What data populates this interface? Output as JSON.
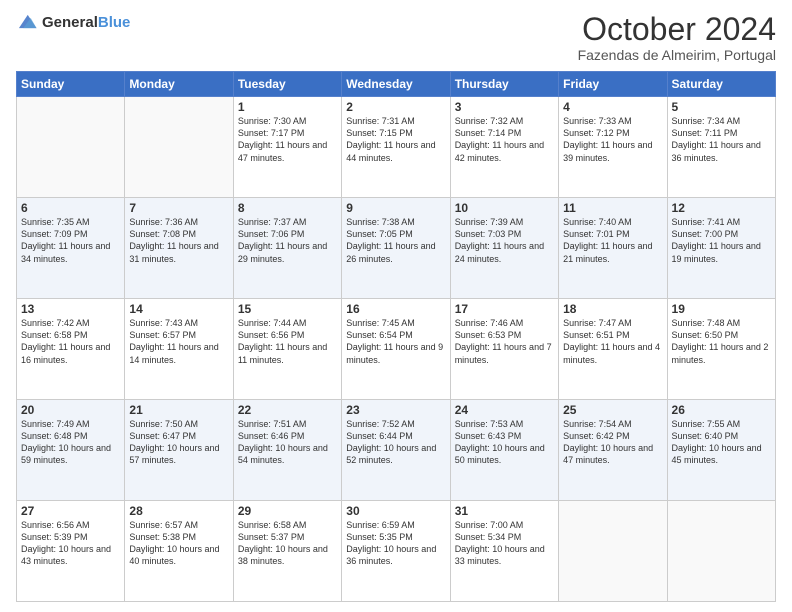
{
  "header": {
    "logo_general": "General",
    "logo_blue": "Blue",
    "main_title": "October 2024",
    "subtitle": "Fazendas de Almeirim, Portugal"
  },
  "days_of_week": [
    "Sunday",
    "Monday",
    "Tuesday",
    "Wednesday",
    "Thursday",
    "Friday",
    "Saturday"
  ],
  "weeks": [
    [
      {
        "day": "",
        "sunrise": "",
        "sunset": "",
        "daylight": ""
      },
      {
        "day": "",
        "sunrise": "",
        "sunset": "",
        "daylight": ""
      },
      {
        "day": "1",
        "sunrise": "Sunrise: 7:30 AM",
        "sunset": "Sunset: 7:17 PM",
        "daylight": "Daylight: 11 hours and 47 minutes."
      },
      {
        "day": "2",
        "sunrise": "Sunrise: 7:31 AM",
        "sunset": "Sunset: 7:15 PM",
        "daylight": "Daylight: 11 hours and 44 minutes."
      },
      {
        "day": "3",
        "sunrise": "Sunrise: 7:32 AM",
        "sunset": "Sunset: 7:14 PM",
        "daylight": "Daylight: 11 hours and 42 minutes."
      },
      {
        "day": "4",
        "sunrise": "Sunrise: 7:33 AM",
        "sunset": "Sunset: 7:12 PM",
        "daylight": "Daylight: 11 hours and 39 minutes."
      },
      {
        "day": "5",
        "sunrise": "Sunrise: 7:34 AM",
        "sunset": "Sunset: 7:11 PM",
        "daylight": "Daylight: 11 hours and 36 minutes."
      }
    ],
    [
      {
        "day": "6",
        "sunrise": "Sunrise: 7:35 AM",
        "sunset": "Sunset: 7:09 PM",
        "daylight": "Daylight: 11 hours and 34 minutes."
      },
      {
        "day": "7",
        "sunrise": "Sunrise: 7:36 AM",
        "sunset": "Sunset: 7:08 PM",
        "daylight": "Daylight: 11 hours and 31 minutes."
      },
      {
        "day": "8",
        "sunrise": "Sunrise: 7:37 AM",
        "sunset": "Sunset: 7:06 PM",
        "daylight": "Daylight: 11 hours and 29 minutes."
      },
      {
        "day": "9",
        "sunrise": "Sunrise: 7:38 AM",
        "sunset": "Sunset: 7:05 PM",
        "daylight": "Daylight: 11 hours and 26 minutes."
      },
      {
        "day": "10",
        "sunrise": "Sunrise: 7:39 AM",
        "sunset": "Sunset: 7:03 PM",
        "daylight": "Daylight: 11 hours and 24 minutes."
      },
      {
        "day": "11",
        "sunrise": "Sunrise: 7:40 AM",
        "sunset": "Sunset: 7:01 PM",
        "daylight": "Daylight: 11 hours and 21 minutes."
      },
      {
        "day": "12",
        "sunrise": "Sunrise: 7:41 AM",
        "sunset": "Sunset: 7:00 PM",
        "daylight": "Daylight: 11 hours and 19 minutes."
      }
    ],
    [
      {
        "day": "13",
        "sunrise": "Sunrise: 7:42 AM",
        "sunset": "Sunset: 6:58 PM",
        "daylight": "Daylight: 11 hours and 16 minutes."
      },
      {
        "day": "14",
        "sunrise": "Sunrise: 7:43 AM",
        "sunset": "Sunset: 6:57 PM",
        "daylight": "Daylight: 11 hours and 14 minutes."
      },
      {
        "day": "15",
        "sunrise": "Sunrise: 7:44 AM",
        "sunset": "Sunset: 6:56 PM",
        "daylight": "Daylight: 11 hours and 11 minutes."
      },
      {
        "day": "16",
        "sunrise": "Sunrise: 7:45 AM",
        "sunset": "Sunset: 6:54 PM",
        "daylight": "Daylight: 11 hours and 9 minutes."
      },
      {
        "day": "17",
        "sunrise": "Sunrise: 7:46 AM",
        "sunset": "Sunset: 6:53 PM",
        "daylight": "Daylight: 11 hours and 7 minutes."
      },
      {
        "day": "18",
        "sunrise": "Sunrise: 7:47 AM",
        "sunset": "Sunset: 6:51 PM",
        "daylight": "Daylight: 11 hours and 4 minutes."
      },
      {
        "day": "19",
        "sunrise": "Sunrise: 7:48 AM",
        "sunset": "Sunset: 6:50 PM",
        "daylight": "Daylight: 11 hours and 2 minutes."
      }
    ],
    [
      {
        "day": "20",
        "sunrise": "Sunrise: 7:49 AM",
        "sunset": "Sunset: 6:48 PM",
        "daylight": "Daylight: 10 hours and 59 minutes."
      },
      {
        "day": "21",
        "sunrise": "Sunrise: 7:50 AM",
        "sunset": "Sunset: 6:47 PM",
        "daylight": "Daylight: 10 hours and 57 minutes."
      },
      {
        "day": "22",
        "sunrise": "Sunrise: 7:51 AM",
        "sunset": "Sunset: 6:46 PM",
        "daylight": "Daylight: 10 hours and 54 minutes."
      },
      {
        "day": "23",
        "sunrise": "Sunrise: 7:52 AM",
        "sunset": "Sunset: 6:44 PM",
        "daylight": "Daylight: 10 hours and 52 minutes."
      },
      {
        "day": "24",
        "sunrise": "Sunrise: 7:53 AM",
        "sunset": "Sunset: 6:43 PM",
        "daylight": "Daylight: 10 hours and 50 minutes."
      },
      {
        "day": "25",
        "sunrise": "Sunrise: 7:54 AM",
        "sunset": "Sunset: 6:42 PM",
        "daylight": "Daylight: 10 hours and 47 minutes."
      },
      {
        "day": "26",
        "sunrise": "Sunrise: 7:55 AM",
        "sunset": "Sunset: 6:40 PM",
        "daylight": "Daylight: 10 hours and 45 minutes."
      }
    ],
    [
      {
        "day": "27",
        "sunrise": "Sunrise: 6:56 AM",
        "sunset": "Sunset: 5:39 PM",
        "daylight": "Daylight: 10 hours and 43 minutes."
      },
      {
        "day": "28",
        "sunrise": "Sunrise: 6:57 AM",
        "sunset": "Sunset: 5:38 PM",
        "daylight": "Daylight: 10 hours and 40 minutes."
      },
      {
        "day": "29",
        "sunrise": "Sunrise: 6:58 AM",
        "sunset": "Sunset: 5:37 PM",
        "daylight": "Daylight: 10 hours and 38 minutes."
      },
      {
        "day": "30",
        "sunrise": "Sunrise: 6:59 AM",
        "sunset": "Sunset: 5:35 PM",
        "daylight": "Daylight: 10 hours and 36 minutes."
      },
      {
        "day": "31",
        "sunrise": "Sunrise: 7:00 AM",
        "sunset": "Sunset: 5:34 PM",
        "daylight": "Daylight: 10 hours and 33 minutes."
      },
      {
        "day": "",
        "sunrise": "",
        "sunset": "",
        "daylight": ""
      },
      {
        "day": "",
        "sunrise": "",
        "sunset": "",
        "daylight": ""
      }
    ]
  ]
}
